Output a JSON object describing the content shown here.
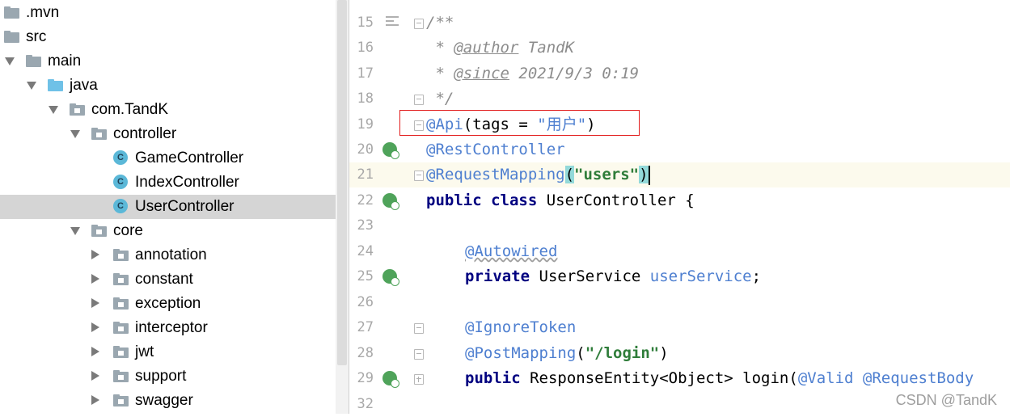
{
  "project_tree": {
    "items": [
      {
        "label": ".mvn",
        "type": "folder",
        "expanded": false
      },
      {
        "label": "src",
        "type": "folder",
        "expanded": false
      },
      {
        "label": "main",
        "type": "folder",
        "expanded": true
      },
      {
        "label": "java",
        "type": "source-folder",
        "expanded": true
      },
      {
        "label": "com.TandK",
        "type": "package",
        "expanded": true
      },
      {
        "label": "controller",
        "type": "package",
        "expanded": true
      },
      {
        "label": "GameController",
        "type": "class"
      },
      {
        "label": "IndexController",
        "type": "class"
      },
      {
        "label": "UserController",
        "type": "class",
        "selected": true
      },
      {
        "label": "core",
        "type": "package",
        "expanded": true
      },
      {
        "label": "annotation",
        "type": "package",
        "expanded": false
      },
      {
        "label": "constant",
        "type": "package",
        "expanded": false
      },
      {
        "label": "exception",
        "type": "package",
        "expanded": false
      },
      {
        "label": "interceptor",
        "type": "package",
        "expanded": false
      },
      {
        "label": "jwt",
        "type": "package",
        "expanded": false
      },
      {
        "label": "support",
        "type": "package",
        "expanded": false
      },
      {
        "label": "swagger",
        "type": "package",
        "expanded": false
      }
    ],
    "class_icon_letter": "C"
  },
  "editor": {
    "line_numbers": [
      "15",
      "16",
      "17",
      "18",
      "19",
      "20",
      "21",
      "22",
      "23",
      "24",
      "25",
      "26",
      "27",
      "28",
      "29",
      "32"
    ],
    "lines": {
      "l15_comment": "/**",
      "l16_star": " * ",
      "l16_tag": "@author",
      "l16_text": " TandK",
      "l17_star": " * ",
      "l17_tag": "@since",
      "l17_text": " 2021/9/3 0:19",
      "l18_comment": " */",
      "l19_ann": "@Api",
      "l19_open": "(tags = ",
      "l19_str": "\"用户\"",
      "l19_close": ")",
      "l20_ann": "@RestController",
      "l21_ann": "@RequestMapping",
      "l21_open": "(",
      "l21_str": "\"users\"",
      "l21_close": ")",
      "l22_kw": "public class",
      "l22_rest": " UserController {",
      "l24_ann": "@Autowired",
      "l25_kw": "private",
      "l25_type": " UserService ",
      "l25_field": "userService",
      "l25_end": ";",
      "l27_ann": "@IgnoreToken",
      "l28_ann": "@PostMapping",
      "l28_open": "(",
      "l28_str": "\"/login\"",
      "l28_close": ")",
      "l29_kw": "public",
      "l29_type": " ResponseEntity<Object> login(",
      "l29_ann1": "@Valid",
      "l29_ann2": " @RequestBody"
    }
  },
  "watermark": "CSDN @TandK",
  "colors": {
    "annotation": "#4e7fd0",
    "keyword": "#000080",
    "string": "#2f7d3a",
    "comment": "#8c8c8c",
    "highlight_box": "#e21c1c",
    "selection": "#d5d5d5"
  }
}
